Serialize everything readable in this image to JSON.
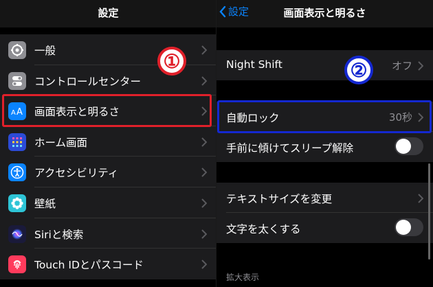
{
  "left_panel": {
    "title": "設定",
    "items": [
      {
        "label": "一般",
        "icon": "gear-icon",
        "color": "#8e8e93"
      },
      {
        "label": "コントロールセンター",
        "icon": "toggles-icon",
        "color": "#8e8e93"
      },
      {
        "label": "画面表示と明るさ",
        "icon": "text-size-icon",
        "color": "#0a84ff"
      },
      {
        "label": "ホーム画面",
        "icon": "home-grid-icon",
        "color": "#2c4bd6"
      },
      {
        "label": "アクセシビリティ",
        "icon": "accessibility-icon",
        "color": "#0a84ff"
      },
      {
        "label": "壁紙",
        "icon": "wallpaper-icon",
        "color": "#2ec4d6"
      },
      {
        "label": "Siriと検索",
        "icon": "siri-icon",
        "color": "#2b2b6e"
      },
      {
        "label": "Touch IDとパスコード",
        "icon": "fingerprint-icon",
        "color": "#ff3b5c"
      }
    ]
  },
  "right_panel": {
    "back_label": "設定",
    "title": "画面表示と明るさ",
    "night_shift": {
      "label": "Night Shift",
      "value": "オフ"
    },
    "auto_lock": {
      "label": "自動ロック",
      "value": "30秒"
    },
    "raise_to_wake": {
      "label": "手前に傾けてスリープ解除",
      "on": false
    },
    "text_size": {
      "label": "テキストサイズを変更"
    },
    "bold_text": {
      "label": "文字を太くする",
      "on": false
    },
    "zoom_header": "拡大表示"
  },
  "annotations": {
    "step1": "①",
    "step2": "②",
    "step1_color": "#e0202a",
    "step2_color": "#1428d0"
  }
}
